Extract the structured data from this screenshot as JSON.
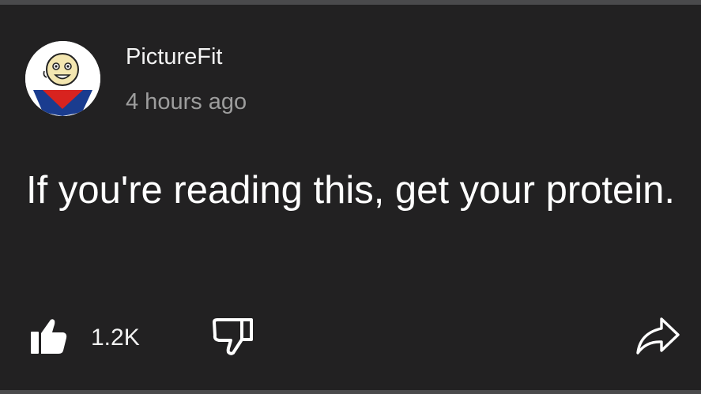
{
  "comment": {
    "author": "PictureFit",
    "timestamp": "4 hours ago",
    "text": "If you're reading this, get your protein.",
    "like_count": "1.2K"
  },
  "icons": {
    "avatar": "cartoon-character-avatar",
    "like": "thumbs-up-filled-icon",
    "dislike": "thumbs-down-outline-icon",
    "share": "share-arrow-icon"
  },
  "colors": {
    "background": "#222122",
    "primary_text": "#ffffff",
    "secondary_text": "#9d9d9d"
  }
}
